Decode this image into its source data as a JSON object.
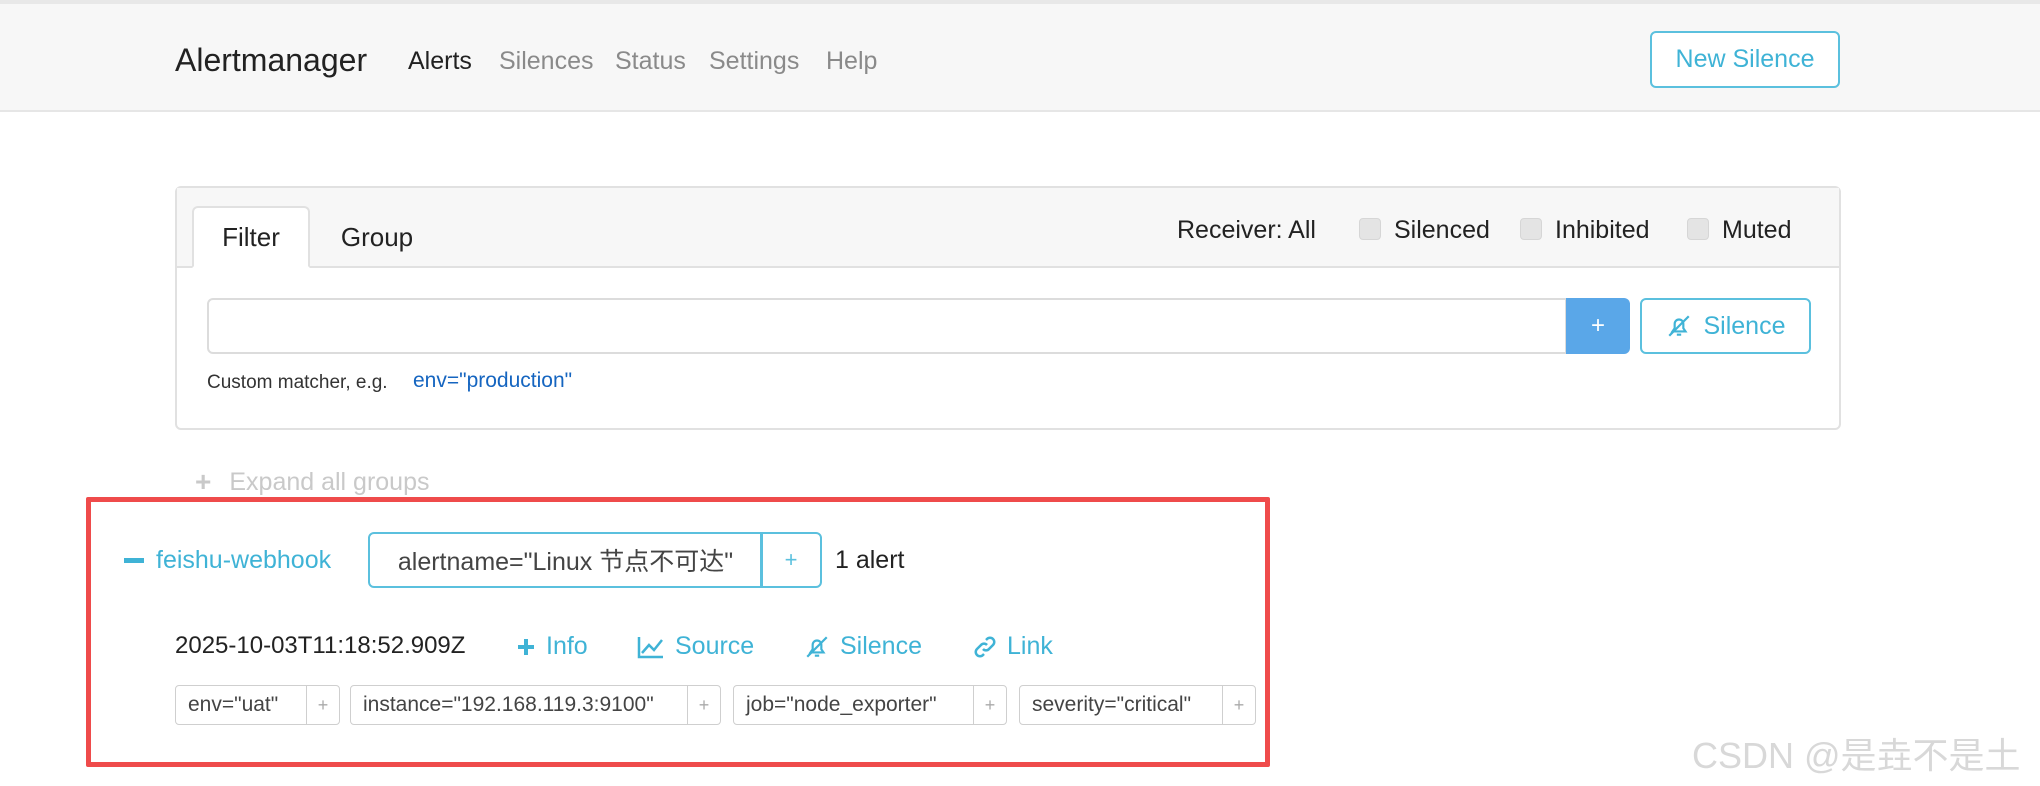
{
  "navbar": {
    "brand": "Alertmanager",
    "links": [
      "Alerts",
      "Silences",
      "Status",
      "Settings",
      "Help"
    ],
    "new_silence_label": "New Silence"
  },
  "filter_card": {
    "tabs": [
      "Filter",
      "Group"
    ],
    "receiver_label": "Receiver: All",
    "checkboxes": [
      "Silenced",
      "Inhibited",
      "Muted"
    ],
    "input_value": "",
    "add_label": "+",
    "silence_label": "Silence",
    "hint_text": "Custom matcher, e.g.",
    "hint_example": "env=\"production\""
  },
  "expand_all_label": "Expand all groups",
  "group": {
    "receiver": "feishu-webhook",
    "matcher": "alertname=\"Linux 节点不可达\"",
    "matcher_add": "+",
    "count": "1 alert",
    "alert": {
      "timestamp": "2025-10-03T11:18:52.909Z",
      "actions": [
        "Info",
        "Source",
        "Silence",
        "Link"
      ],
      "labels": [
        "env=\"uat\"",
        "instance=\"192.168.119.3:9100\"",
        "job=\"node_exporter\"",
        "severity=\"critical\""
      ],
      "label_add": "+"
    }
  },
  "watermark": "CSDN @是垚不是土",
  "colors": {
    "accent": "#3fb3d6",
    "primary_button": "#5aa7e8",
    "highlight_border": "#ef4b4b",
    "navbar_bg": "#f7f7f7"
  }
}
